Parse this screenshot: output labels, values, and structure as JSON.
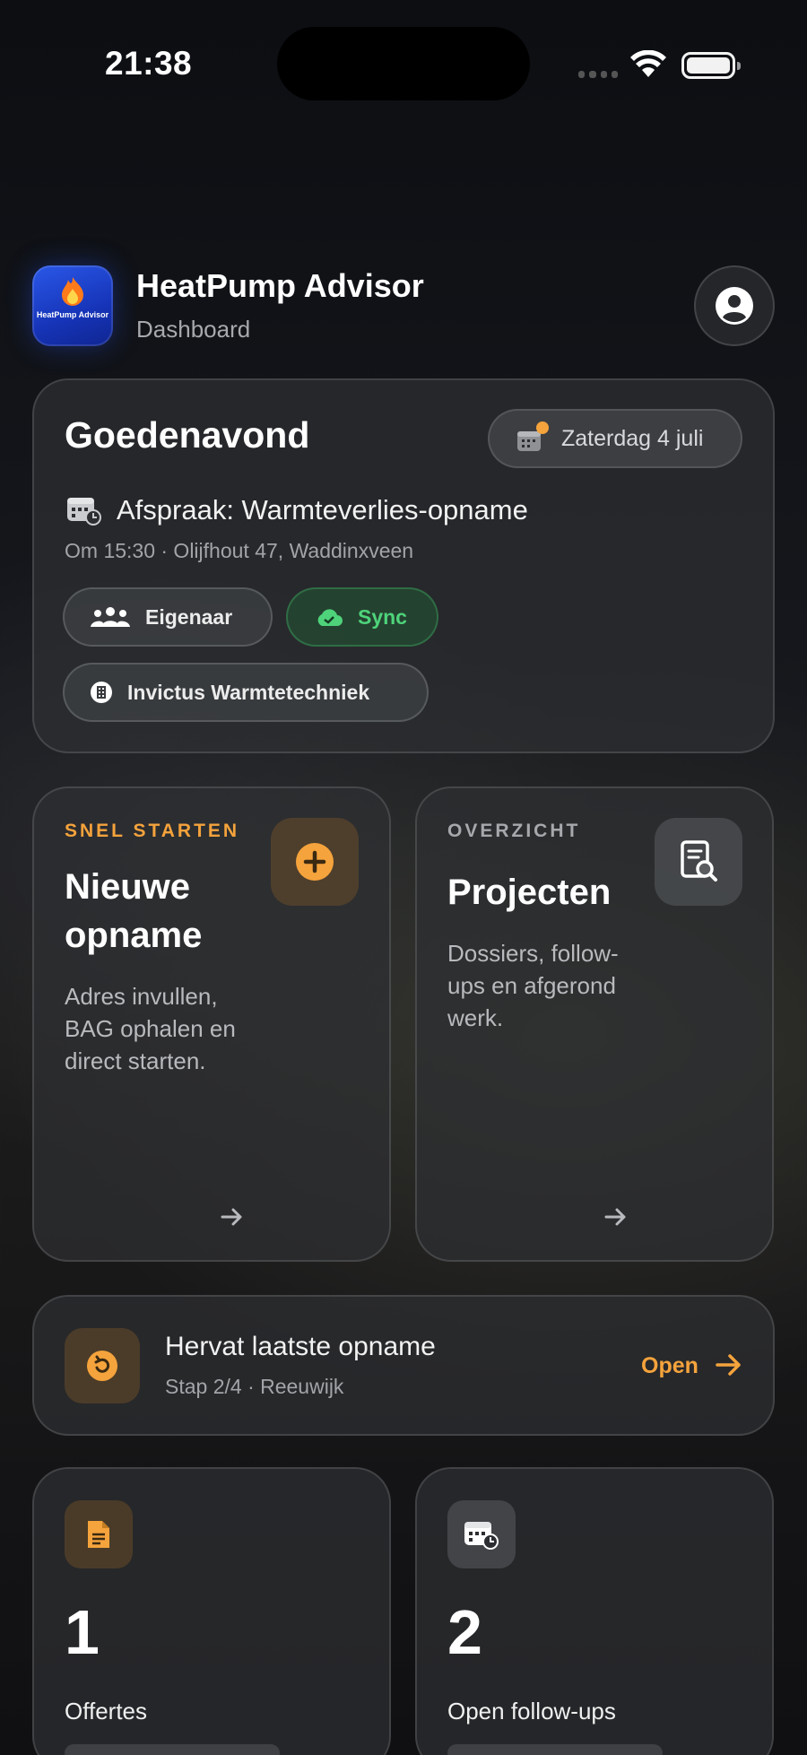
{
  "status_bar": {
    "time": "21:38"
  },
  "header": {
    "app_title": "HeatPump Advisor",
    "subtitle": "Dashboard",
    "icon_text": "HeatPump Advisor"
  },
  "greeting": {
    "title": "Goedenavond",
    "date": "Zaterdag 4 juli",
    "appointment_title": "Afspraak: Warmteverlies-opname",
    "appointment_details": "Om 15:30 · Olijfhout 47, Waddinxveen",
    "chips": {
      "owner": "Eigenaar",
      "sync": "Sync",
      "company": "Invictus Warmtetechniek"
    }
  },
  "tiles": {
    "new": {
      "kicker": "SNEL STARTEN",
      "title": "Nieuwe opname",
      "desc": "Adres invullen, BAG ophalen en direct starten."
    },
    "projects": {
      "kicker": "OVERZICHT",
      "title": "Projecten",
      "desc": "Dossiers, follow-ups en afgerond werk."
    }
  },
  "resume": {
    "title": "Hervat laatste opname",
    "sub": "Stap 2/4 · Reeuwijk",
    "action": "Open"
  },
  "stats": [
    {
      "value": "1",
      "label": "Offertes"
    },
    {
      "value": "2",
      "label": "Open follow-ups"
    }
  ],
  "colors": {
    "accent": "#f5a33c",
    "sync_green": "#4ed37a",
    "app_icon_blue": "#1f46d0"
  }
}
